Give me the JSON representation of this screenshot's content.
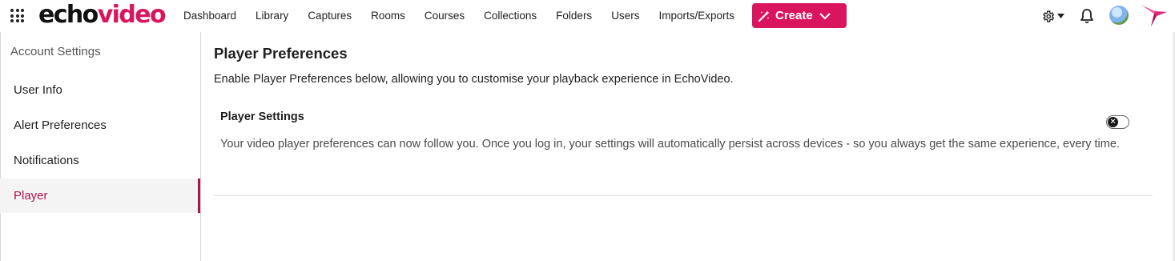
{
  "header": {
    "logo_echo": "echo",
    "logo_video": "video",
    "nav": [
      {
        "label": "Dashboard"
      },
      {
        "label": "Library"
      },
      {
        "label": "Captures"
      },
      {
        "label": "Rooms"
      },
      {
        "label": "Courses"
      },
      {
        "label": "Collections"
      },
      {
        "label": "Folders"
      },
      {
        "label": "Users"
      },
      {
        "label": "Imports/Exports"
      }
    ],
    "create_label": "Create",
    "brand_color": "#d9155d"
  },
  "sidebar": {
    "title": "Account Settings",
    "items": [
      {
        "label": "User Info",
        "active": false
      },
      {
        "label": "Alert Preferences",
        "active": false
      },
      {
        "label": "Notifications",
        "active": false
      },
      {
        "label": "Player",
        "active": true
      }
    ],
    "active_color": "#b0124e"
  },
  "main": {
    "title": "Player Preferences",
    "description": "Enable Player Preferences below, allowing you to customise your playback experience in EchoVideo.",
    "section": {
      "title": "Player Settings",
      "description": "Your video player preferences can now follow you. Once you log in, your settings will automatically persist across devices - so you always get the same experience, every time.",
      "toggle_on": false,
      "toggle_glyph": "×"
    }
  }
}
